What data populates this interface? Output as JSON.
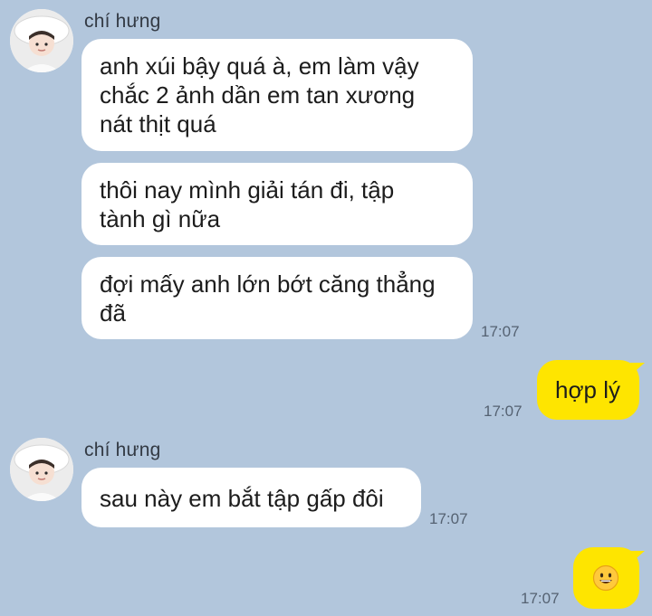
{
  "chat": {
    "groups": [
      {
        "sender": "chí hưng",
        "messages": [
          {
            "lines": [
              "anh xúi bậy quá à, em làm vậy",
              "chắc 2 ảnh dần em tan xương",
              "nát thịt quá"
            ]
          },
          {
            "lines": [
              "thôi nay mình giải tán đi, tập",
              "tành gì nữa"
            ]
          },
          {
            "lines": [
              "đợi mấy anh lớn bớt căng thẳng",
              "đã"
            ],
            "time": "17:07"
          }
        ]
      },
      {
        "sender": "chí hưng",
        "messages": [
          {
            "lines": [
              "sau này em bắt tập gấp đôi"
            ],
            "time": "17:07"
          }
        ]
      }
    ],
    "outgoing": [
      {
        "text": "hợp lý",
        "time": "17:07"
      },
      {
        "emoji": "grinning-face-icon",
        "time": "17:07"
      }
    ]
  },
  "colors": {
    "background": "#b2c6dc",
    "incoming_bubble": "#ffffff",
    "outgoing_bubble": "#fee500",
    "timestamp": "#556272"
  }
}
